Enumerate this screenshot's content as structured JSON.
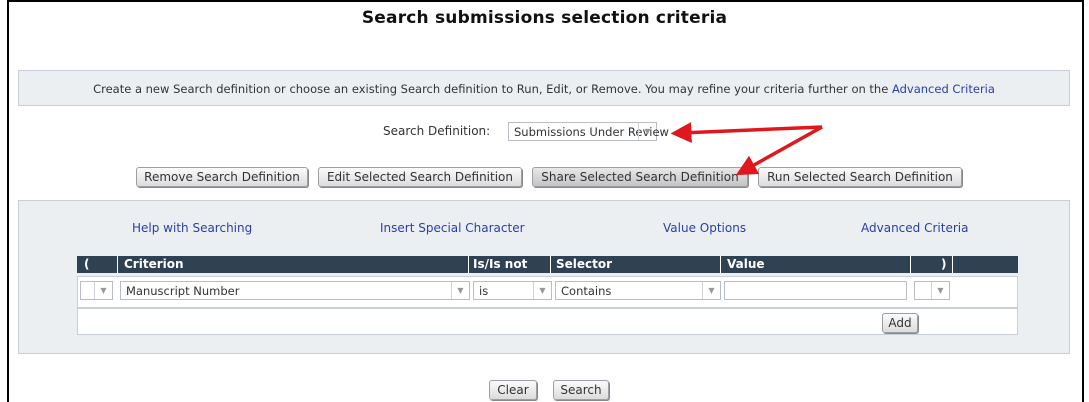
{
  "page": {
    "title": "Search submissions selection criteria",
    "intro_text": "Create a new Search definition or choose an existing Search definition to Run, Edit, or Remove.  You may refine your criteria further on the",
    "intro_link": "Advanced Criteria"
  },
  "search_definition": {
    "label": "Search Definition:",
    "selected": "Submissions Under Review"
  },
  "buttons": {
    "remove": "Remove Search Definition",
    "edit": "Edit Selected Search Definition",
    "share": "Share Selected Search Definition",
    "run": "Run Selected Search Definition",
    "add": "Add",
    "clear": "Clear",
    "search": "Search"
  },
  "criteria_links": {
    "help": "Help with Searching",
    "insert": "Insert Special Character",
    "value_options": "Value Options",
    "advanced": "Advanced Criteria"
  },
  "table": {
    "headers": {
      "open_paren": "(",
      "criterion": "Criterion",
      "is_not": "Is/Is not",
      "selector": "Selector",
      "value": "Value",
      "close_paren": ")"
    },
    "row": {
      "open_paren": "",
      "criterion": "Manuscript Number",
      "is_not": "is",
      "selector": "Contains",
      "value": "",
      "close_paren": ""
    }
  },
  "colors": {
    "header_bg": "#2f4254",
    "panel_bg": "#eceff2",
    "link": "#2b3ea8",
    "annotation_arrow": "#e0171c"
  }
}
